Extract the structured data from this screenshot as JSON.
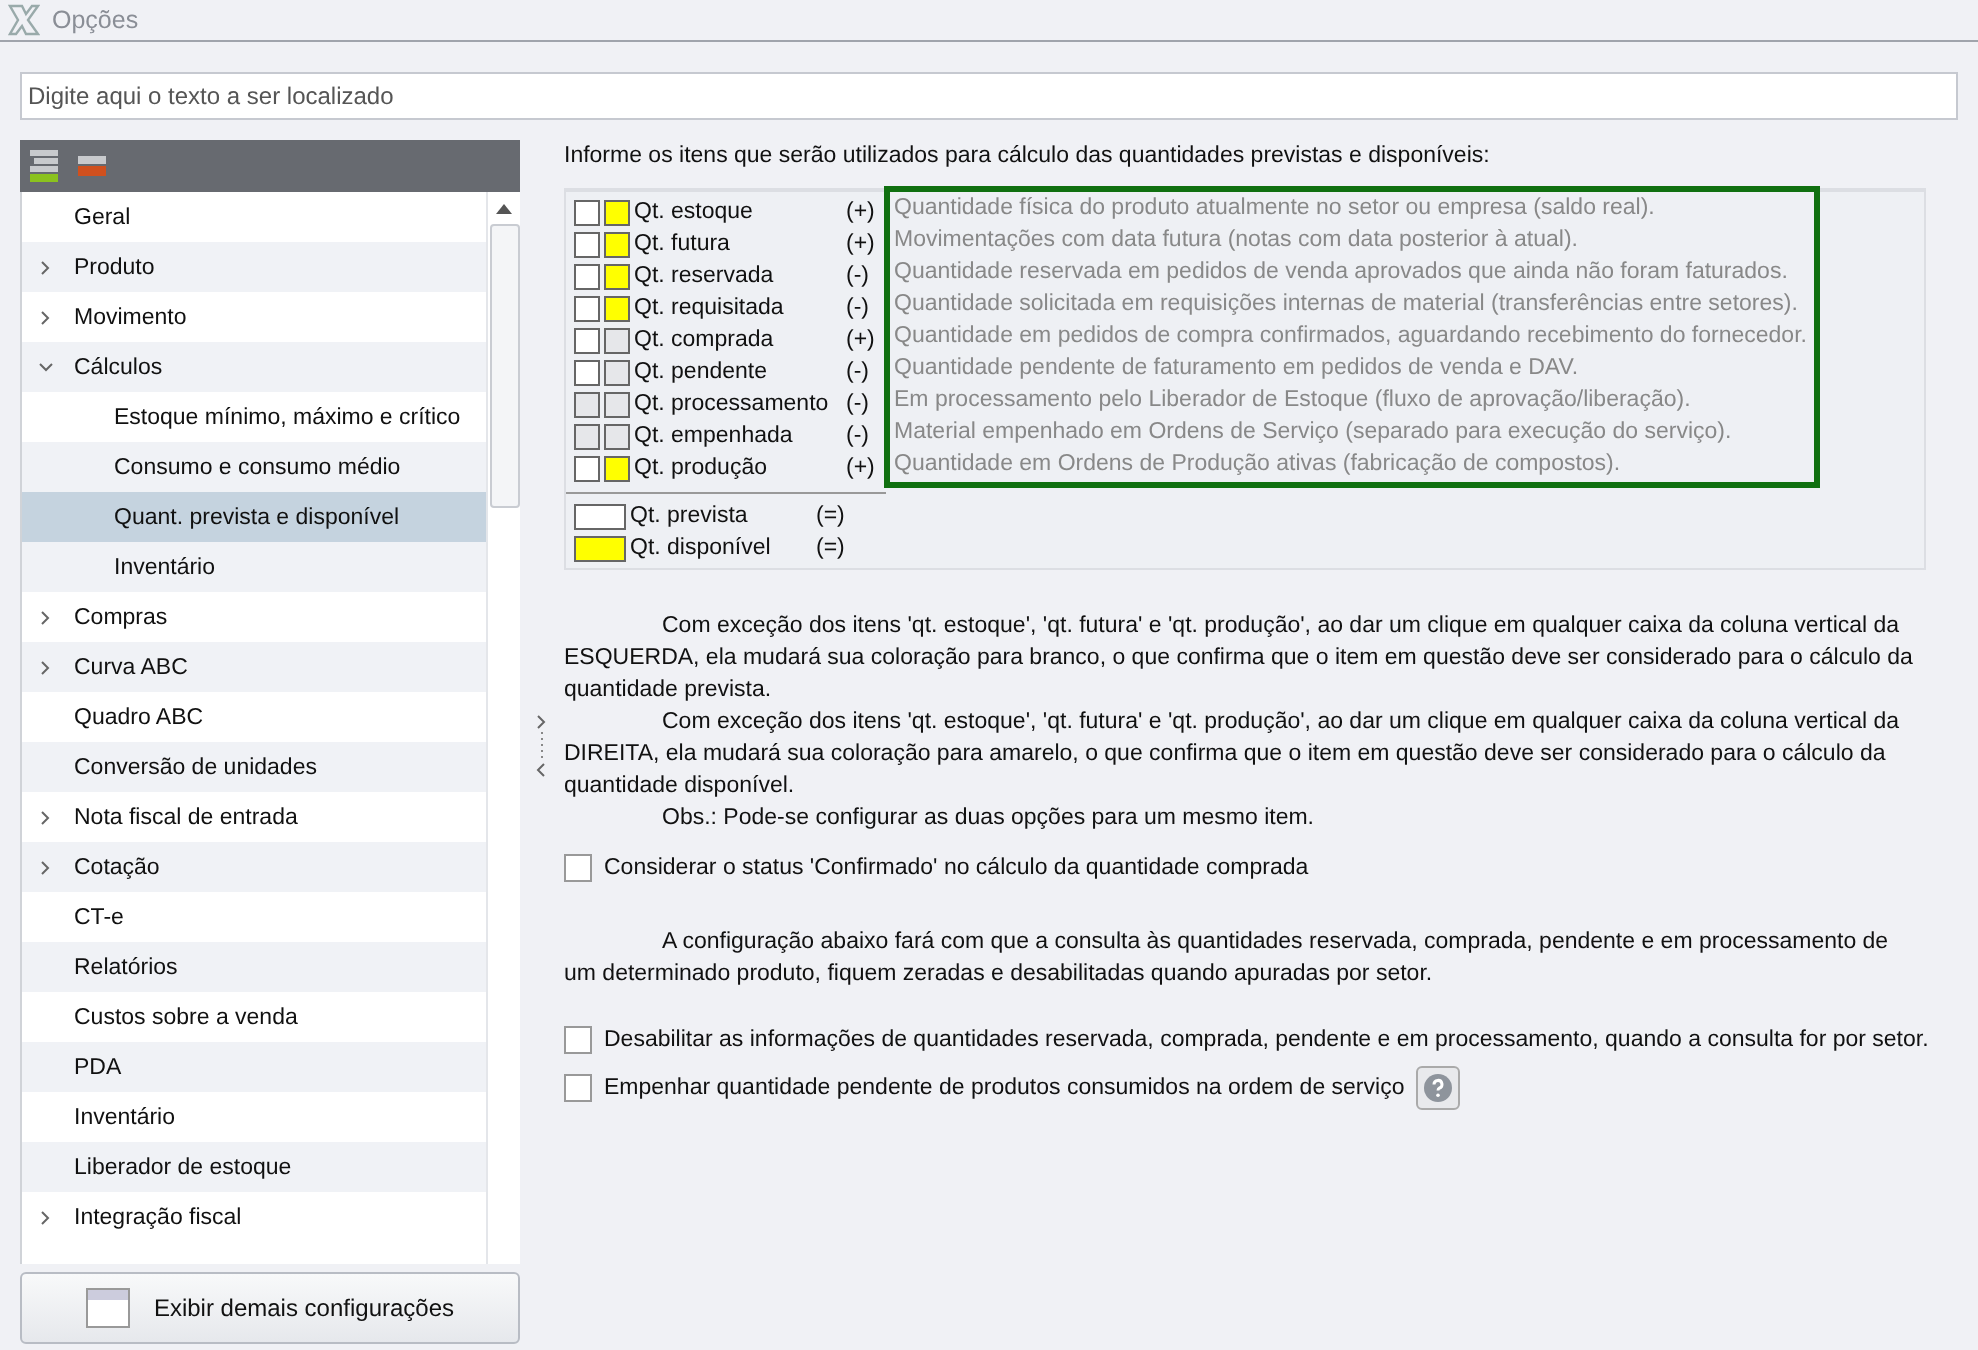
{
  "window": {
    "title": "Opções"
  },
  "search": {
    "placeholder": "Digite aqui o texto a ser localizado"
  },
  "tree": [
    {
      "label": "Geral",
      "kind": "leaf",
      "selected": false
    },
    {
      "label": "Produto",
      "kind": "group",
      "expanded": false,
      "selected": false
    },
    {
      "label": "Movimento",
      "kind": "group",
      "expanded": false,
      "selected": false
    },
    {
      "label": "Cálculos",
      "kind": "group",
      "expanded": true,
      "selected": false,
      "children": [
        {
          "label": "Estoque mínimo, máximo e crítico",
          "kind": "leaf",
          "selected": false
        },
        {
          "label": "Consumo e consumo médio",
          "kind": "leaf",
          "selected": false
        },
        {
          "label": "Quant. prevista e disponível",
          "kind": "leaf",
          "selected": true
        },
        {
          "label": "Inventário",
          "kind": "leaf",
          "selected": false
        }
      ]
    },
    {
      "label": "Compras",
      "kind": "group",
      "expanded": false,
      "selected": false
    },
    {
      "label": "Curva ABC",
      "kind": "group",
      "expanded": false,
      "selected": false
    },
    {
      "label": "Quadro ABC",
      "kind": "leaf",
      "selected": false
    },
    {
      "label": "Conversão de unidades",
      "kind": "leaf",
      "selected": false
    },
    {
      "label": "Nota fiscal de entrada",
      "kind": "group",
      "expanded": false,
      "selected": false
    },
    {
      "label": "Cotação",
      "kind": "group",
      "expanded": false,
      "selected": false
    },
    {
      "label": "CT-e",
      "kind": "leaf",
      "selected": false
    },
    {
      "label": "Relatórios",
      "kind": "leaf",
      "selected": false
    },
    {
      "label": "Custos sobre a venda",
      "kind": "leaf",
      "selected": false
    },
    {
      "label": "PDA",
      "kind": "leaf",
      "selected": false
    },
    {
      "label": "Inventário",
      "kind": "leaf",
      "selected": false
    },
    {
      "label": "Liberador de estoque",
      "kind": "leaf",
      "selected": false
    },
    {
      "label": "Integração fiscal",
      "kind": "group",
      "expanded": false,
      "selected": false
    }
  ],
  "more_button": {
    "label": "Exibir demais configurações"
  },
  "heading": "Informe os itens que serão utilizados para cálculo das quantidades previstas e disponíveis:",
  "items": [
    {
      "name": "Qt. estoque",
      "sign": "(+)",
      "description": "Quantidade física do produto atualmente no setor ou empresa (saldo real).",
      "left_selected": true,
      "right_selected": true
    },
    {
      "name": "Qt. futura",
      "sign": "(+)",
      "description": "Movimentações com data futura (notas com data posterior à atual).",
      "left_selected": true,
      "right_selected": true
    },
    {
      "name": "Qt. reservada",
      "sign": "(-)",
      "description": "Quantidade reservada em pedidos de venda aprovados que ainda não foram faturados.",
      "left_selected": true,
      "right_selected": true
    },
    {
      "name": "Qt. requisitada",
      "sign": "(-)",
      "description": "Quantidade solicitada em requisições internas de material (transferências entre setores).",
      "left_selected": true,
      "right_selected": true
    },
    {
      "name": "Qt. comprada",
      "sign": "(+)",
      "description": "Quantidade em pedidos de compra confirmados, aguardando recebimento do fornecedor.",
      "left_selected": true,
      "right_selected": false
    },
    {
      "name": "Qt. pendente",
      "sign": "(-)",
      "description": "Quantidade pendente de faturamento em pedidos de venda e DAV.",
      "left_selected": true,
      "right_selected": false
    },
    {
      "name": "Qt. processamento",
      "sign": "(-)",
      "description": "Em processamento pelo Liberador de Estoque (fluxo de aprovação/liberação).",
      "left_selected": false,
      "right_selected": false
    },
    {
      "name": "Qt. empenhada",
      "sign": "(-)",
      "description": "Material empenhado em Ordens de Serviço (separado para execução do serviço).",
      "left_selected": false,
      "right_selected": false
    },
    {
      "name": "Qt. produção",
      "sign": "(+)",
      "description": "Quantidade em Ordens de Produção ativas (fabricação de compostos).",
      "left_selected": true,
      "right_selected": true
    }
  ],
  "results": [
    {
      "name": "Qt. prevista",
      "sign": "(=)",
      "kind": "prevista"
    },
    {
      "name": "Qt. disponível",
      "sign": "(=)",
      "kind": "disponivel"
    }
  ],
  "explanation": [
    "Com exceção dos itens 'qt. estoque', 'qt. futura' e 'qt. produção', ao dar um clique em qualquer caixa da coluna vertical da ESQUERDA, ela mudará sua coloração para branco, o que confirma que o item em questão deve ser considerado para o cálculo da quantidade prevista.",
    "Com exceção dos itens 'qt. estoque', 'qt. futura' e 'qt. produção', ao dar um clique em qualquer caixa da coluna vertical da DIREITA, ela mudará sua coloração para amarelo, o que confirma que o item em questão deve ser considerado para o cálculo da quantidade disponível.",
    "Obs.: Pode-se configurar as duas opções para um mesmo item."
  ],
  "option_confirmado": {
    "label": "Considerar o status 'Confirmado' no cálculo da quantidade comprada",
    "checked": false
  },
  "note": "A configuração abaixo fará com que a consulta às quantidades reservada, comprada, pendente e em processamento de um determinado produto, fiquem zeradas e desabilitadas quando apuradas por setor.",
  "options": [
    {
      "label": "Desabilitar as informações de quantidades reservada, comprada, pendente e em processamento, quando a consulta for por setor.",
      "checked": false,
      "help": false
    },
    {
      "label": "Empenhar quantidade pendente de produtos consumidos na ordem de serviço",
      "checked": false,
      "help": true
    }
  ]
}
